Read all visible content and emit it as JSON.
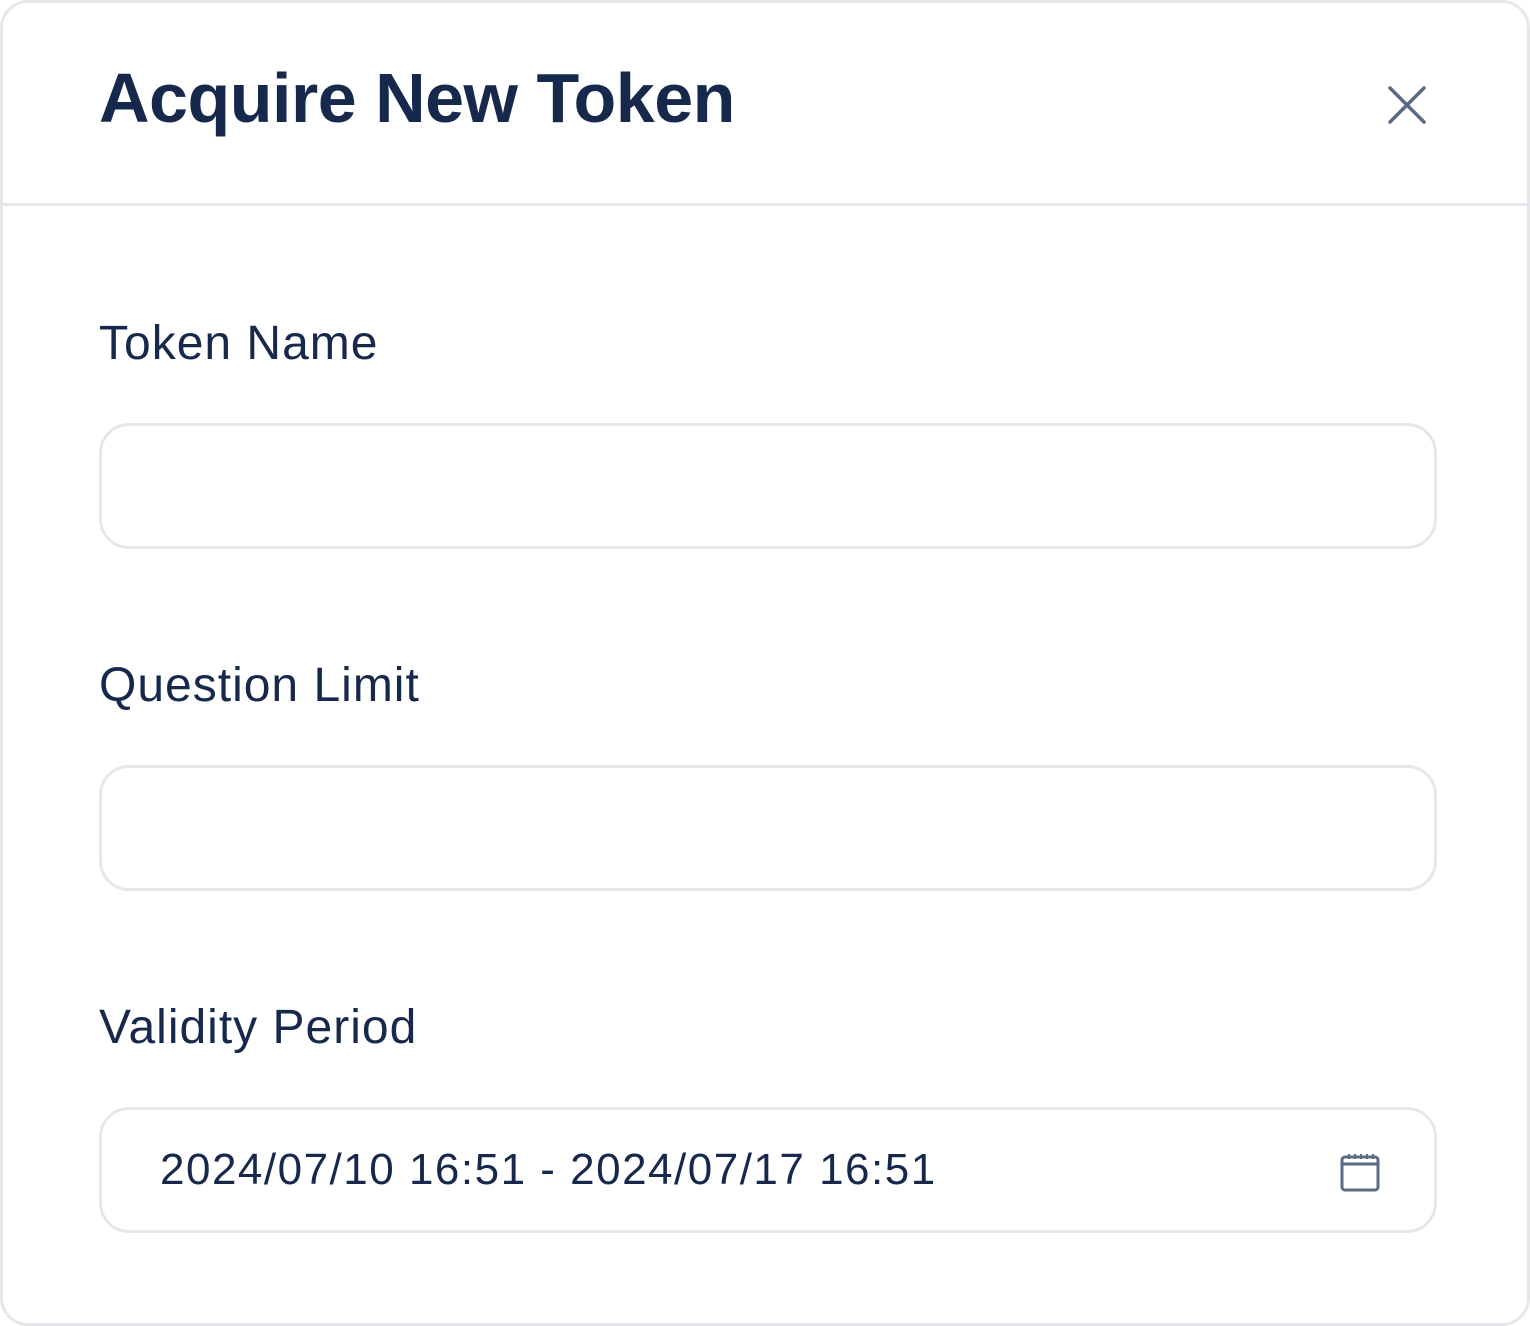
{
  "dialog": {
    "title": "Acquire New Token",
    "close_icon": "close-icon"
  },
  "form": {
    "token_name": {
      "label": "Token Name",
      "value": "",
      "placeholder": ""
    },
    "question_limit": {
      "label": "Question Limit",
      "value": "",
      "placeholder": ""
    },
    "validity_period": {
      "label": "Validity Period",
      "value": "2024/07/10 16:51 - 2024/07/17 16:51",
      "icon": "calendar-icon"
    }
  },
  "colors": {
    "text_primary": "#16294d",
    "border": "#e5e7eb",
    "icon": "#5c6b85",
    "background": "#ffffff"
  }
}
